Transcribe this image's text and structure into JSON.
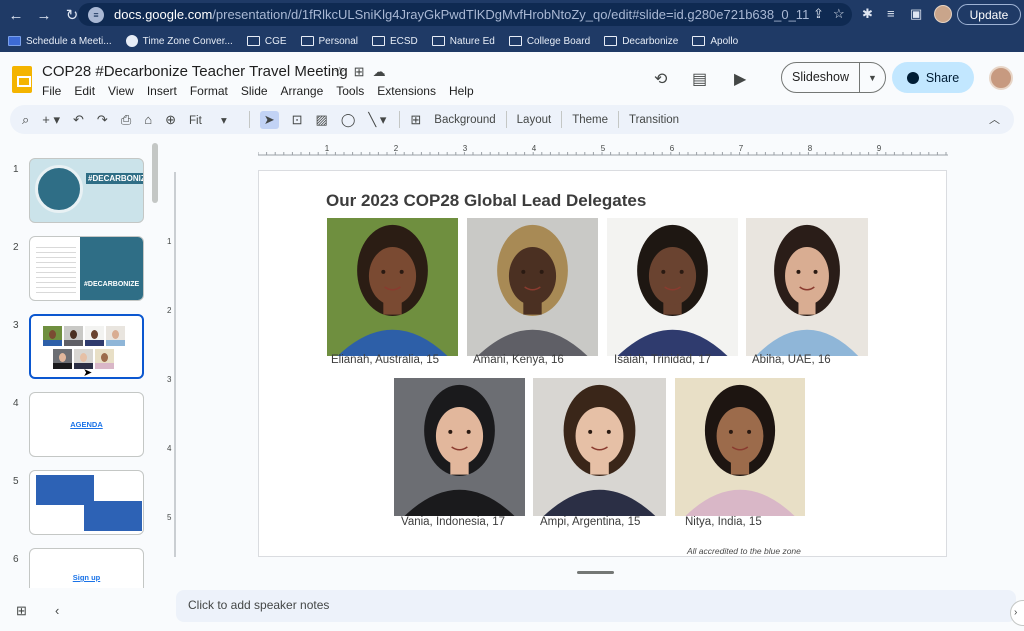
{
  "browser": {
    "url_host": "docs.google.com",
    "url_path": "/presentation/d/1fRlkcULSniKlg4JrayGkPwdTlKDgMvfHrobNtoZy_qo/edit#slide=id.g280e721b638_0_11",
    "update_label": "Update",
    "bookmarks": [
      {
        "label": "Schedule a Meeti..."
      },
      {
        "label": "Time Zone Conver..."
      },
      {
        "label": "CGE"
      },
      {
        "label": "Personal"
      },
      {
        "label": "ECSD"
      },
      {
        "label": "Nature Ed"
      },
      {
        "label": "College Board"
      },
      {
        "label": "Decarbonize"
      },
      {
        "label": "Apollo"
      }
    ]
  },
  "app": {
    "title": "COP28 #Decarbonize Teacher Travel Meeting",
    "menu": [
      "File",
      "Edit",
      "View",
      "Insert",
      "Format",
      "Slide",
      "Arrange",
      "Tools",
      "Extensions",
      "Help"
    ],
    "slideshow_label": "Slideshow",
    "share_label": "Share"
  },
  "toolbar": {
    "zoom_label": "Fit",
    "background_label": "Background",
    "layout_label": "Layout",
    "theme_label": "Theme",
    "transition_label": "Transition"
  },
  "filmstrip": {
    "selected": 3,
    "slides": [
      {
        "number": "1",
        "thumb_text": "#DECARBONIZE"
      },
      {
        "number": "2",
        "thumb_text": "#DECARBONIZE"
      },
      {
        "number": "3",
        "thumb_text": ""
      },
      {
        "number": "4",
        "thumb_text": "AGENDA"
      },
      {
        "number": "5",
        "thumb_text": ""
      },
      {
        "number": "6",
        "thumb_text": "Sign up"
      }
    ]
  },
  "rulers": {
    "horizontal": [
      "1",
      "2",
      "3",
      "4",
      "5",
      "6",
      "7",
      "8",
      "9"
    ],
    "vertical": [
      "1",
      "2",
      "3",
      "4",
      "5"
    ]
  },
  "slide": {
    "title": "Our 2023 COP28 Global Lead Delegates",
    "delegates": [
      {
        "caption": "Elianah, Australia, 15",
        "bg": "#6f8f3f",
        "shirt": "#2d5fa8",
        "hair": "#2b1d14",
        "skin": "#7a4a32"
      },
      {
        "caption": "Amani, Kenya, 16",
        "bg": "#c9c9c6",
        "shirt": "#5f5f66",
        "hair": "#a88a55",
        "skin": "#4b3022"
      },
      {
        "caption": "Isaiah, Trinidad, 17",
        "bg": "#f3f3f1",
        "shirt": "#2f3b6e",
        "hair": "#1e1712",
        "skin": "#6a4330"
      },
      {
        "caption": "Abiha, UAE, 16",
        "bg": "#e9e5df",
        "shirt": "#8fb6d8",
        "hair": "#2a1d18",
        "skin": "#d9ad92"
      },
      {
        "caption": "Vania, Indonesia, 17",
        "bg": "#6c6e73",
        "shirt": "#1a1a1c",
        "hair": "#1a1a1c",
        "skin": "#e2b79c"
      },
      {
        "caption": "Ampi, Argentina, 15",
        "bg": "#d8d6d2",
        "shirt": "#2b2f45",
        "hair": "#3a2619",
        "skin": "#e6c0a6"
      },
      {
        "caption": "Nitya, India, 15",
        "bg": "#e8dfc6",
        "shirt": "#d9b7c7",
        "hair": "#1d1511",
        "skin": "#9c6b4b"
      }
    ],
    "footnote": "All accredited to the blue zone"
  },
  "notes": {
    "placeholder": "Click to add speaker notes"
  }
}
